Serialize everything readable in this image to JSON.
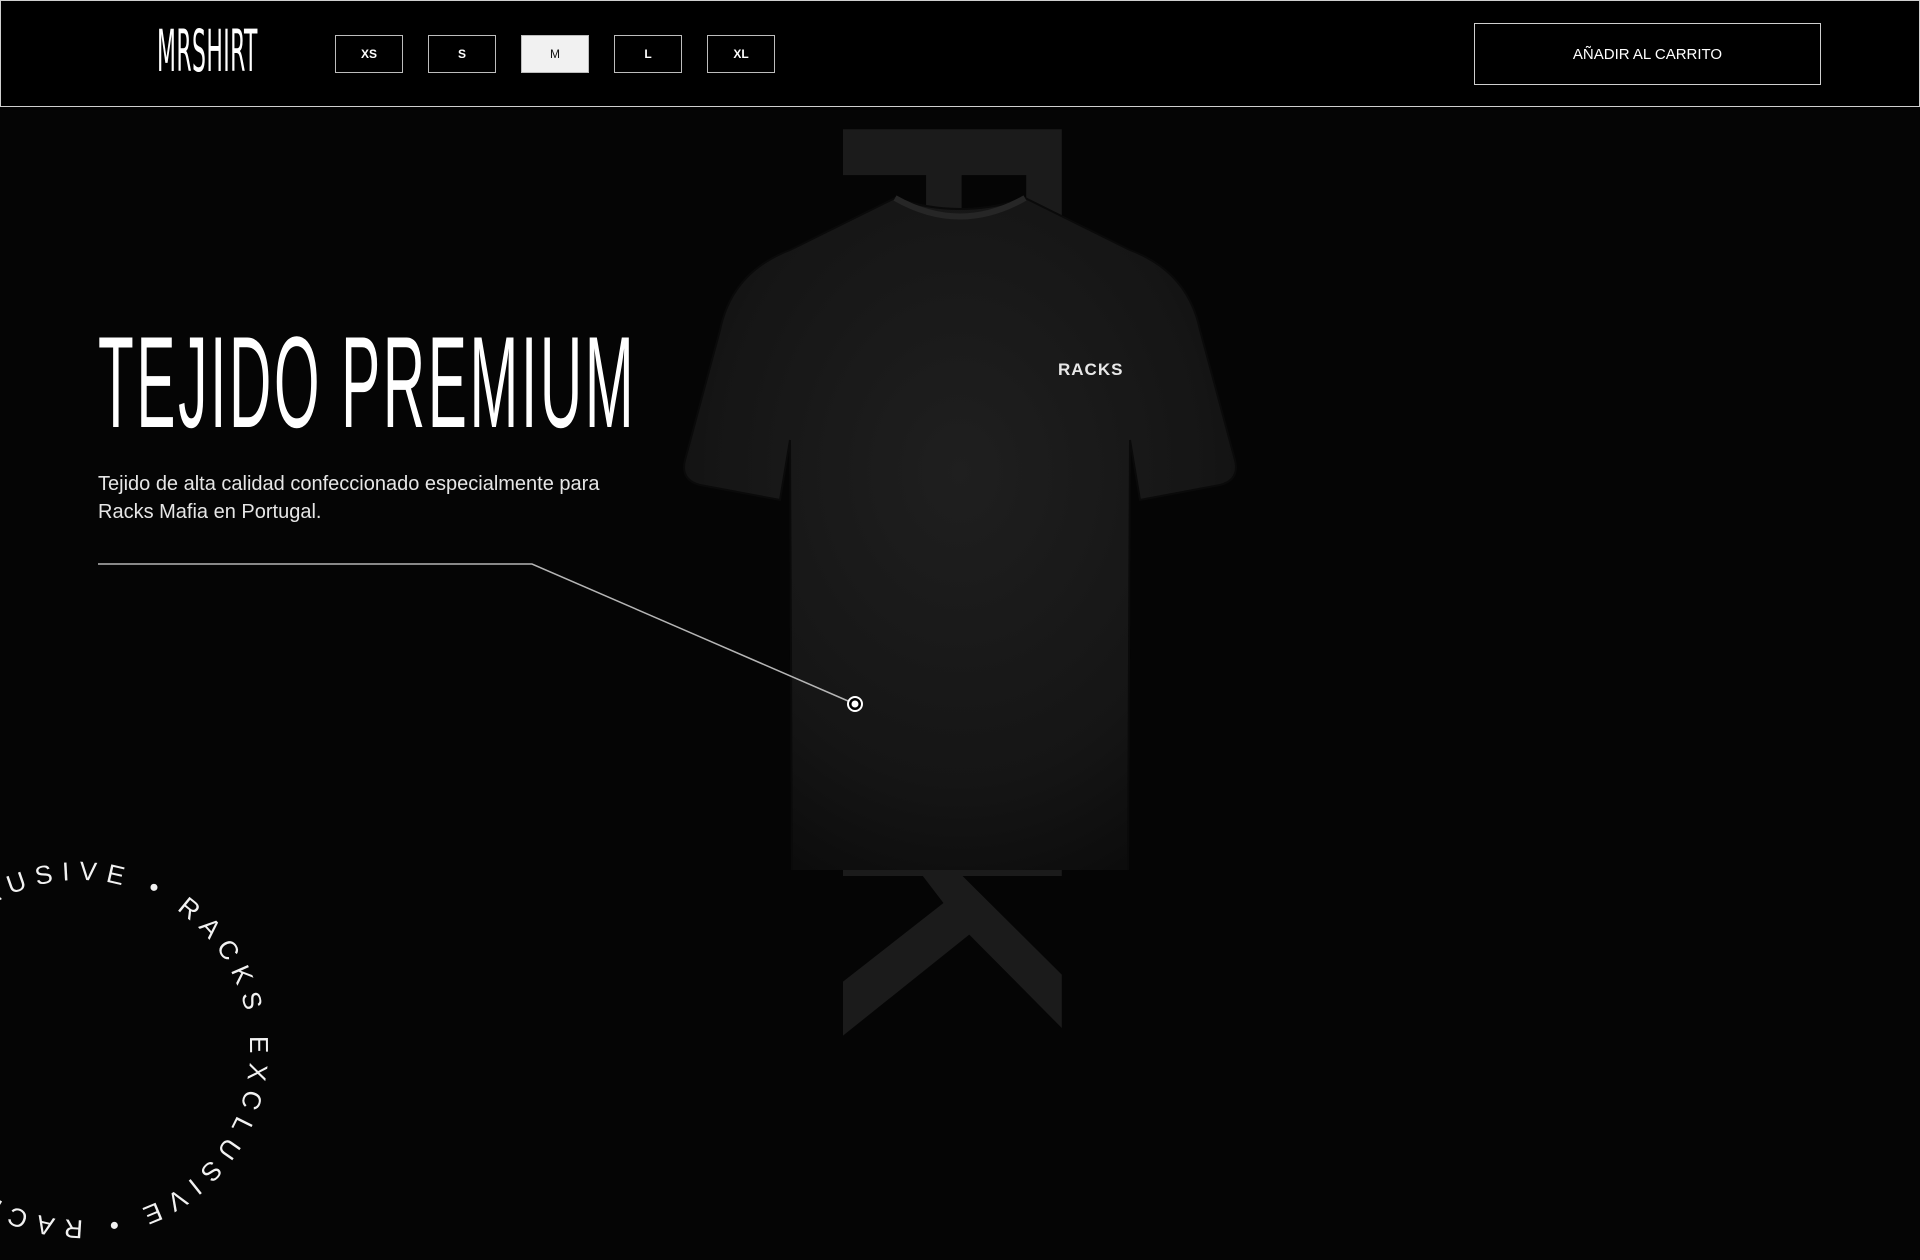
{
  "header": {
    "logo": "MRSHIRT",
    "sizes": [
      {
        "label": "XS",
        "selected": false
      },
      {
        "label": "S",
        "selected": false
      },
      {
        "label": "M",
        "selected": true
      },
      {
        "label": "L",
        "selected": false
      },
      {
        "label": "XL",
        "selected": false
      }
    ],
    "cart_label": "AÑADIR AL CARRITO"
  },
  "background_word": "RACKS",
  "product": {
    "chest_logo": "RACKS"
  },
  "feature": {
    "title": "TEJIDO PREMIUM",
    "description": "Tejido de alta calidad confeccionado especialmente para Racks Mafia en Portugal."
  },
  "badge": {
    "ring_text": "RACKS EXCLUSIVE • RACKS EXCLUSIVE • RACKS EXCLUSIVE • "
  },
  "colors": {
    "background": "#050505",
    "accent": "#ffffff"
  }
}
